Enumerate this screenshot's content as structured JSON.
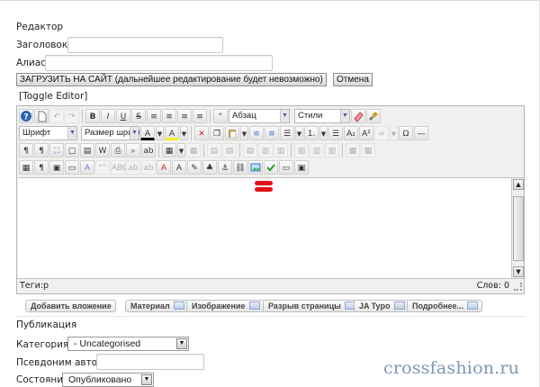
{
  "section_editor": "Редактор",
  "fields": {
    "title_label": "Заголовок",
    "required_mark": "*",
    "alias_label": "Алиас"
  },
  "actions": {
    "upload": "ЗАГРУЗИТЬ НА САЙТ (дальнейшее редактирование будет невозможно)",
    "cancel": "Отмена",
    "toggle_editor": "[Toggle Editor]"
  },
  "toolbar": {
    "bold": "B",
    "italic": "I",
    "underline": "U",
    "strike": "S",
    "quote": "“",
    "format_select": "Абзац",
    "styles_select": "Стили",
    "font_select": "Шрифт",
    "size_select": "Размер шрифта",
    "font_color": "A",
    "highlight": "A",
    "ordered_list": "1.",
    "subscript": "A₂",
    "superscript": "A²",
    "omega": "Ω",
    "pilcrow": "¶"
  },
  "statusbar": {
    "path_label": "Теги:",
    "path_value": "p",
    "words_label": "Слов:",
    "words_value": "0"
  },
  "editor_buttons": [
    {
      "label": "Добавить вложение"
    },
    {
      "label": "Материал"
    },
    {
      "label": "Изображение"
    },
    {
      "label": "Разрыв страницы"
    },
    {
      "label": "JA Typo"
    },
    {
      "label": "Подробнее..."
    }
  ],
  "publishing": {
    "title": "Публикация",
    "category_label": "Категория",
    "category_value": "- Uncategorised",
    "author_alias_label": "Псевдоним автора",
    "state_label": "Состояние",
    "state_value": "Опубликовано"
  },
  "watermark": "crossfashion.ru",
  "colors": {
    "marker": "#e3111b",
    "watermark": "#7c98b4",
    "help_icon": "#2f63b5"
  }
}
